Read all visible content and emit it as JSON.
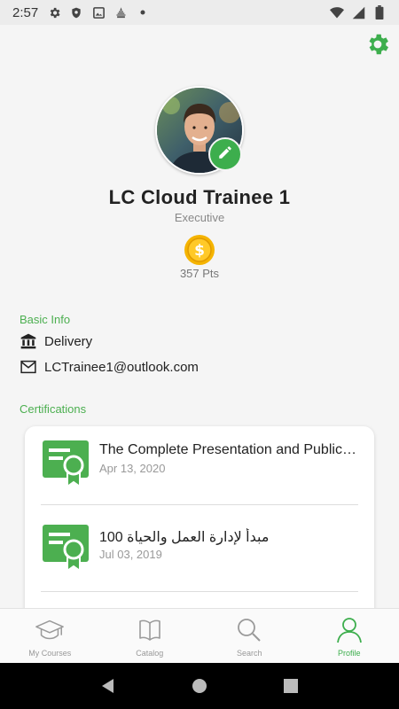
{
  "status_bar": {
    "time": "2:57"
  },
  "profile": {
    "name": "LC Cloud Trainee 1",
    "role": "Executive",
    "points": "357 Pts",
    "coin_symbol": "$"
  },
  "basic_info": {
    "label": "Basic Info",
    "department": "Delivery",
    "email": "LCTrainee1@outlook.com"
  },
  "certifications": {
    "label": "Certifications",
    "items": [
      {
        "title": "The Complete Presentation and Public Speaking/Speech Course",
        "date": "Apr 13, 2020"
      },
      {
        "title": "100 مبدأ لإدارة العمل والحياة",
        "date": "Jul 03, 2019"
      }
    ]
  },
  "bottom_nav": [
    {
      "label": "My Courses",
      "icon": "graduation-cap-icon"
    },
    {
      "label": "Catalog",
      "icon": "book-icon"
    },
    {
      "label": "Search",
      "icon": "search-icon"
    },
    {
      "label": "Profile",
      "icon": "person-icon"
    }
  ],
  "colors": {
    "accent": "#3dae4d",
    "coin": "#f5b400"
  }
}
